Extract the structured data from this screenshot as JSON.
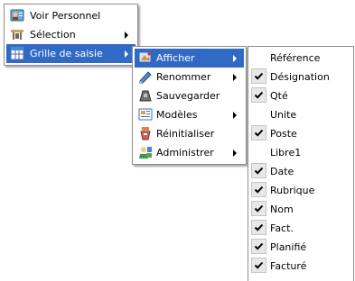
{
  "menu1": {
    "items": [
      {
        "label": "Voir Personnel",
        "icon": "person-card-icon",
        "submenu": false,
        "highlighted": false
      },
      {
        "label": "Sélection",
        "icon": "selection-icon",
        "submenu": true,
        "highlighted": false
      },
      {
        "label": "Grille de saisie",
        "icon": "grid-icon",
        "submenu": true,
        "highlighted": true
      }
    ]
  },
  "menu2": {
    "items": [
      {
        "label": "Afficher",
        "icon": "display-icon",
        "submenu": true,
        "highlighted": true
      },
      {
        "label": "Renommer",
        "icon": "rename-icon",
        "submenu": true,
        "highlighted": false
      },
      {
        "label": "Sauvegarder",
        "icon": "save-icon",
        "submenu": false,
        "highlighted": false
      },
      {
        "label": "Modèles",
        "icon": "templates-icon",
        "submenu": true,
        "highlighted": false
      },
      {
        "label": "Réinitialiser",
        "icon": "reset-icon",
        "submenu": false,
        "highlighted": false
      },
      {
        "label": "Administrer",
        "icon": "admin-icon",
        "submenu": true,
        "highlighted": false
      }
    ]
  },
  "menu3": {
    "items": [
      {
        "label": "Référence",
        "checked": false
      },
      {
        "label": "Désignation",
        "checked": true
      },
      {
        "label": "Qté",
        "checked": true
      },
      {
        "label": "Unite",
        "checked": false
      },
      {
        "label": "Poste",
        "checked": true
      },
      {
        "label": "Libre1",
        "checked": false
      },
      {
        "label": "Date",
        "checked": true
      },
      {
        "label": "Rubrique",
        "checked": true
      },
      {
        "label": "Nom",
        "checked": true
      },
      {
        "label": "Fact.",
        "checked": true
      },
      {
        "label": "Planifié",
        "checked": true
      },
      {
        "label": "Facturé",
        "checked": true
      }
    ]
  },
  "colors": {
    "highlight": "#316ac5",
    "border": "#8d8d8d",
    "check_bg": "#e8e8e8"
  }
}
